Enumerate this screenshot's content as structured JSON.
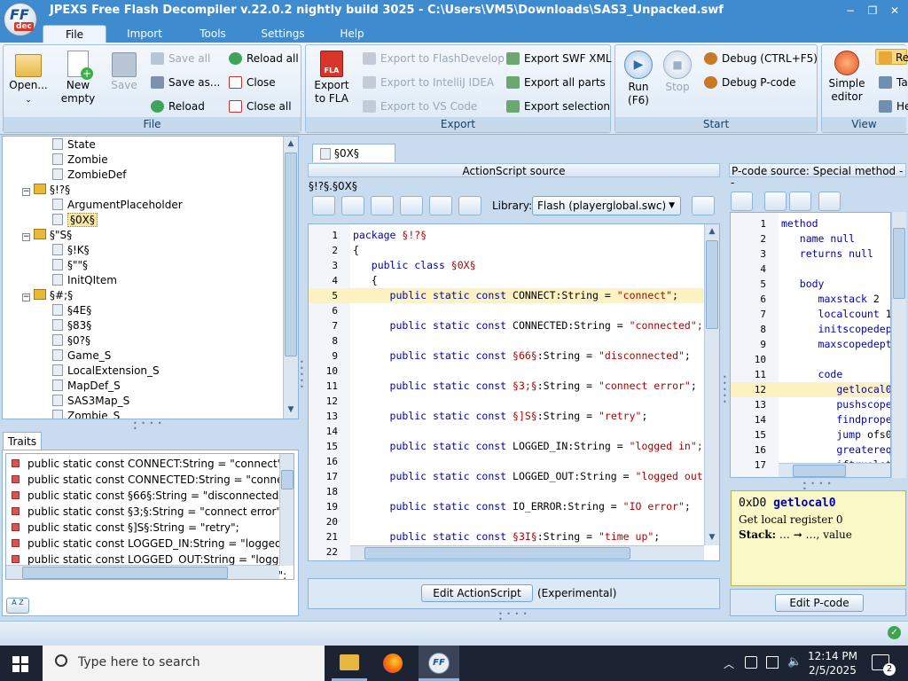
{
  "window": {
    "title": "JPEXS Free Flash Decompiler v.22.0.2 nightly build 3025 - C:\\Users\\VM5\\Downloads\\SAS3_Unpacked.swf",
    "logo_text": "FF",
    "logo_sub": "dec",
    "minimize": "−",
    "restore": "❐",
    "close": "✕"
  },
  "ribbon_tabs": [
    "File",
    "Import",
    "Tools",
    "Settings",
    "Help"
  ],
  "ribbon": {
    "file": {
      "label": "File",
      "open": "Open...",
      "new_empty": "New empty",
      "save": "Save",
      "save_all": "Save all",
      "save_as": "Save as...",
      "reload": "Reload",
      "reload_all": "Reload all",
      "close": "Close",
      "close_all": "Close all"
    },
    "export": {
      "label": "Export",
      "export_to_fla": "Export to FLA",
      "fla_badge": "FLA",
      "to_flashdevelop": "Export to FlashDevelop",
      "to_intellij": "Export to IntelliJ IDEA",
      "to_vscode": "Export to VS Code",
      "swf_xml": "Export SWF XML",
      "all_parts": "Export all parts",
      "selection": "Export selection"
    },
    "start": {
      "label": "Start",
      "run": "Run",
      "run_key": "(F6)",
      "stop": "Stop",
      "debug": "Debug (CTRL+F5)",
      "debug_pcode": "Debug P-code"
    },
    "view": {
      "label": "View",
      "simple_editor": "Simple editor",
      "r1": "Re",
      "r2": "Ta",
      "r3": "He"
    }
  },
  "tree": {
    "items": [
      {
        "indent": 3,
        "type": "doc",
        "label": "State"
      },
      {
        "indent": 3,
        "type": "doc",
        "label": "Zombie"
      },
      {
        "indent": 3,
        "type": "doc",
        "label": "ZombieDef"
      },
      {
        "indent": 1,
        "type": "pkg",
        "label": "§!?§"
      },
      {
        "indent": 3,
        "type": "doc",
        "label": "ArgumentPlaceholder"
      },
      {
        "indent": 3,
        "type": "doc",
        "label": "§0X§",
        "selected": true
      },
      {
        "indent": 1,
        "type": "pkg",
        "label": "§\"S§"
      },
      {
        "indent": 3,
        "type": "doc",
        "label": "§!K§"
      },
      {
        "indent": 3,
        "type": "doc",
        "label": "§\"\"§"
      },
      {
        "indent": 3,
        "type": "doc",
        "label": "InitQItem"
      },
      {
        "indent": 1,
        "type": "pkg",
        "label": "§#;§"
      },
      {
        "indent": 3,
        "type": "doc",
        "label": "§4E§"
      },
      {
        "indent": 3,
        "type": "doc",
        "label": "§83§"
      },
      {
        "indent": 3,
        "type": "doc",
        "label": "§0?§"
      },
      {
        "indent": 3,
        "type": "doc",
        "label": "Game_S"
      },
      {
        "indent": 3,
        "type": "doc",
        "label": "LocalExtension_S"
      },
      {
        "indent": 3,
        "type": "doc",
        "label": "MapDef_S"
      },
      {
        "indent": 3,
        "type": "doc",
        "label": "SAS3Map_S"
      },
      {
        "indent": 3,
        "type": "doc",
        "label": "Zombie_S"
      }
    ]
  },
  "traits": {
    "tab": "Traits",
    "sort_label": "A Z",
    "rows": [
      "public static const CONNECT:String = \"connect\";",
      "public static const CONNECTED:String = \"connected",
      "public static const §66§:String = \"disconnected\";",
      "public static const §3;§:String = \"connect error\";",
      "public static const §]S§:String = \"retry\";",
      "public static const LOGGED_IN:String = \"logged in\";",
      "public static const LOGGED_OUT:String = \"logged ou",
      "public static const IO_ERROR:String = \"IO error\";"
    ]
  },
  "editor": {
    "tab": "§0X§",
    "header": "ActionScript source",
    "path": "§!?§.§0X§",
    "library_label": "Library:",
    "library_value": "Flash (playerglobal.swc)",
    "edit_button": "Edit ActionScript",
    "experimental": "(Experimental)",
    "current_line": 5,
    "lines": [
      [
        {
          "c": "kw",
          "t": "package "
        },
        {
          "c": "str",
          "t": "§!?§"
        }
      ],
      [
        {
          "c": "pl",
          "t": "{"
        }
      ],
      [
        {
          "c": "pl",
          "t": "   "
        },
        {
          "c": "kw",
          "t": "public class "
        },
        {
          "c": "str",
          "t": "§0X§"
        }
      ],
      [
        {
          "c": "pl",
          "t": "   {"
        }
      ],
      [
        {
          "c": "pl",
          "t": "      "
        },
        {
          "c": "kw",
          "t": "public static const "
        },
        {
          "c": "pl",
          "t": "CONNECT:String = "
        },
        {
          "c": "str",
          "t": "\"connect\""
        },
        {
          "c": "pl",
          "t": ";"
        }
      ],
      [],
      [
        {
          "c": "pl",
          "t": "      "
        },
        {
          "c": "kw",
          "t": "public static const "
        },
        {
          "c": "pl",
          "t": "CONNECTED:String = "
        },
        {
          "c": "str",
          "t": "\"connected\";"
        }
      ],
      [],
      [
        {
          "c": "pl",
          "t": "      "
        },
        {
          "c": "kw",
          "t": "public static const "
        },
        {
          "c": "str",
          "t": "§66§"
        },
        {
          "c": "pl",
          "t": ":String = "
        },
        {
          "c": "str",
          "t": "\"disconnected\""
        },
        {
          "c": "pl",
          "t": ";"
        }
      ],
      [],
      [
        {
          "c": "pl",
          "t": "      "
        },
        {
          "c": "kw",
          "t": "public static const "
        },
        {
          "c": "str",
          "t": "§3;§"
        },
        {
          "c": "pl",
          "t": ":String = "
        },
        {
          "c": "str",
          "t": "\"connect error\""
        },
        {
          "c": "pl",
          "t": ";"
        }
      ],
      [],
      [
        {
          "c": "pl",
          "t": "      "
        },
        {
          "c": "kw",
          "t": "public static const "
        },
        {
          "c": "str",
          "t": "§]S§"
        },
        {
          "c": "pl",
          "t": ":String = "
        },
        {
          "c": "str",
          "t": "\"retry\""
        },
        {
          "c": "pl",
          "t": ";"
        }
      ],
      [],
      [
        {
          "c": "pl",
          "t": "      "
        },
        {
          "c": "kw",
          "t": "public static const "
        },
        {
          "c": "pl",
          "t": "LOGGED_IN:String = "
        },
        {
          "c": "str",
          "t": "\"logged in\";"
        }
      ],
      [],
      [
        {
          "c": "pl",
          "t": "      "
        },
        {
          "c": "kw",
          "t": "public static const "
        },
        {
          "c": "pl",
          "t": "LOGGED_OUT:String = "
        },
        {
          "c": "str",
          "t": "\"logged out"
        }
      ],
      [],
      [
        {
          "c": "pl",
          "t": "      "
        },
        {
          "c": "kw",
          "t": "public static const "
        },
        {
          "c": "pl",
          "t": "IO_ERROR:String = "
        },
        {
          "c": "str",
          "t": "\"IO error\""
        },
        {
          "c": "pl",
          "t": ";"
        }
      ],
      [],
      [
        {
          "c": "pl",
          "t": "      "
        },
        {
          "c": "kw",
          "t": "public static const "
        },
        {
          "c": "str",
          "t": "§3I§"
        },
        {
          "c": "pl",
          "t": ":String = "
        },
        {
          "c": "str",
          "t": "\"time up\""
        },
        {
          "c": "pl",
          "t": ";"
        }
      ],
      []
    ]
  },
  "pcode": {
    "header": "P-code source: Special method - C...",
    "dash": "-",
    "edit_button": "Edit P-code",
    "current_line": 12,
    "lines": [
      [
        {
          "c": "kw",
          "t": "method"
        }
      ],
      [
        {
          "c": "pl",
          "t": "   "
        },
        {
          "c": "kw",
          "t": "name "
        },
        {
          "c": "kw",
          "t": "null"
        }
      ],
      [
        {
          "c": "pl",
          "t": "   "
        },
        {
          "c": "kw",
          "t": "returns "
        },
        {
          "c": "kw",
          "t": "null"
        }
      ],
      [],
      [
        {
          "c": "pl",
          "t": "   "
        },
        {
          "c": "kw",
          "t": "body"
        }
      ],
      [
        {
          "c": "pl",
          "t": "      "
        },
        {
          "c": "kw",
          "t": "maxstack "
        },
        {
          "c": "pl",
          "t": "2"
        }
      ],
      [
        {
          "c": "pl",
          "t": "      "
        },
        {
          "c": "kw",
          "t": "localcount "
        },
        {
          "c": "pl",
          "t": "1"
        }
      ],
      [
        {
          "c": "pl",
          "t": "      "
        },
        {
          "c": "kw",
          "t": "initscopedep"
        }
      ],
      [
        {
          "c": "pl",
          "t": "      "
        },
        {
          "c": "kw",
          "t": "maxscopedept"
        }
      ],
      [],
      [
        {
          "c": "pl",
          "t": "      "
        },
        {
          "c": "kw",
          "t": "code"
        }
      ],
      [
        {
          "c": "pl",
          "t": "         "
        },
        {
          "c": "kw",
          "t": "getlocal0"
        }
      ],
      [
        {
          "c": "pl",
          "t": "         "
        },
        {
          "c": "kw",
          "t": "pushscope"
        }
      ],
      [
        {
          "c": "pl",
          "t": "         "
        },
        {
          "c": "kw",
          "t": "findprope"
        }
      ],
      [
        {
          "c": "pl",
          "t": "         "
        },
        {
          "c": "kw",
          "t": "jump "
        },
        {
          "c": "pl",
          "t": "ofs0"
        }
      ],
      [
        {
          "c": "pl",
          "t": "         "
        },
        {
          "c": "kw",
          "t": "greatereq"
        }
      ],
      [
        {
          "c": "pl",
          "t": "         "
        },
        {
          "c": "kw",
          "t": "iftruelst"
        }
      ]
    ],
    "doc": {
      "opcode": "0xD0",
      "name": "getlocal0",
      "desc": "Get local register 0",
      "stack_label": "Stack:",
      "stack_value": "… ➞ …, value"
    }
  },
  "taskbar": {
    "search_placeholder": "Type here to search",
    "time": "12:14 PM",
    "date": "2/5/2025",
    "notifications": "2"
  },
  "colors": {
    "titlebar": "#3f8bd0",
    "current_line": "#fdf3c2",
    "doc_panel": "#fbf8c8"
  }
}
